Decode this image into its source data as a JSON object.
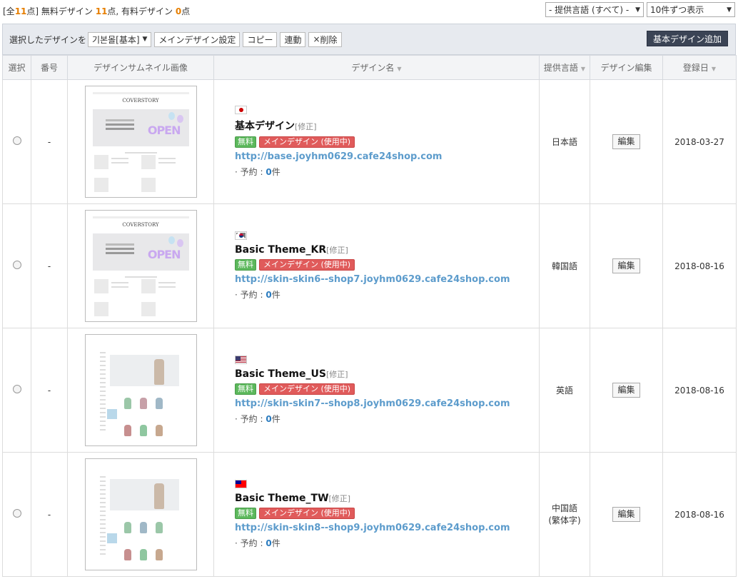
{
  "summary": {
    "prefix": "[全",
    "total": "11",
    "mid": "点] 無料デザイン",
    "free": "11",
    "mid2": "点, 有料デザイン",
    "paid": "0",
    "suffix": "点"
  },
  "filters": {
    "language": "- 提供言語 (すべて) -",
    "per_page": "10件ずつ表示"
  },
  "actions": {
    "label": "選択したデザインを",
    "design_select": "기본몰[基本]",
    "set_main": "メインデザイン設定",
    "copy": "コピー",
    "link": "連動",
    "delete": "削除",
    "delete_icon": "×",
    "add_basic": "基本デザイン追加"
  },
  "columns": {
    "select": "選択",
    "number": "番号",
    "thumbnail": "デザインサムネイル画像",
    "name": "デザイン名",
    "language": "提供言語",
    "edit": "デザイン編集",
    "date": "登録日"
  },
  "rows": [
    {
      "number": "-",
      "flag": "jp-flag",
      "name": "基本デザイン",
      "edit_link": "[修正]",
      "badge_free": "無料",
      "badge_main": "メインデザイン (使用中)",
      "url": "http://base.joyhm0629.cafe24shop.com",
      "reserve_label": "予約 :",
      "reserve_count": "0",
      "reserve_unit": "件",
      "language": "日本語",
      "edit_button": "編集",
      "date": "2018-03-27"
    },
    {
      "number": "-",
      "flag": "kr-flag",
      "name": "Basic Theme_KR",
      "edit_link": "[修正]",
      "badge_free": "無料",
      "badge_main": "メインデザイン (使用中)",
      "url": "http://skin-skin6--shop7.joyhm0629.cafe24shop.com",
      "reserve_label": "予約 :",
      "reserve_count": "0",
      "reserve_unit": "件",
      "language": "韓国語",
      "edit_button": "編集",
      "date": "2018-08-16"
    },
    {
      "number": "-",
      "flag": "us-flag",
      "name": "Basic Theme_US",
      "edit_link": "[修正]",
      "badge_free": "無料",
      "badge_main": "メインデザイン (使用中)",
      "url": "http://skin-skin7--shop8.joyhm0629.cafe24shop.com",
      "reserve_label": "予約 :",
      "reserve_count": "0",
      "reserve_unit": "件",
      "language": "英語",
      "edit_button": "編集",
      "date": "2018-08-16"
    },
    {
      "number": "-",
      "flag": "tw-flag",
      "name": "Basic Theme_TW",
      "edit_link": "[修正]",
      "badge_free": "無料",
      "badge_main": "メインデザイン (使用中)",
      "url": "http://skin-skin8--shop9.joyhm0629.cafe24shop.com",
      "reserve_label": "予約 :",
      "reserve_count": "0",
      "reserve_unit": "件",
      "language": "中国語\n(繁体字)",
      "edit_button": "編集",
      "date": "2018-08-16"
    }
  ],
  "thumbnails": {
    "logo": "COVERSTORY",
    "banner_word": "OPEN"
  },
  "colors": {
    "add_button_bg": "#3b4455",
    "free_badge": "#5cb85c",
    "main_badge": "#e05b5b",
    "url": "#5d9ccc"
  }
}
